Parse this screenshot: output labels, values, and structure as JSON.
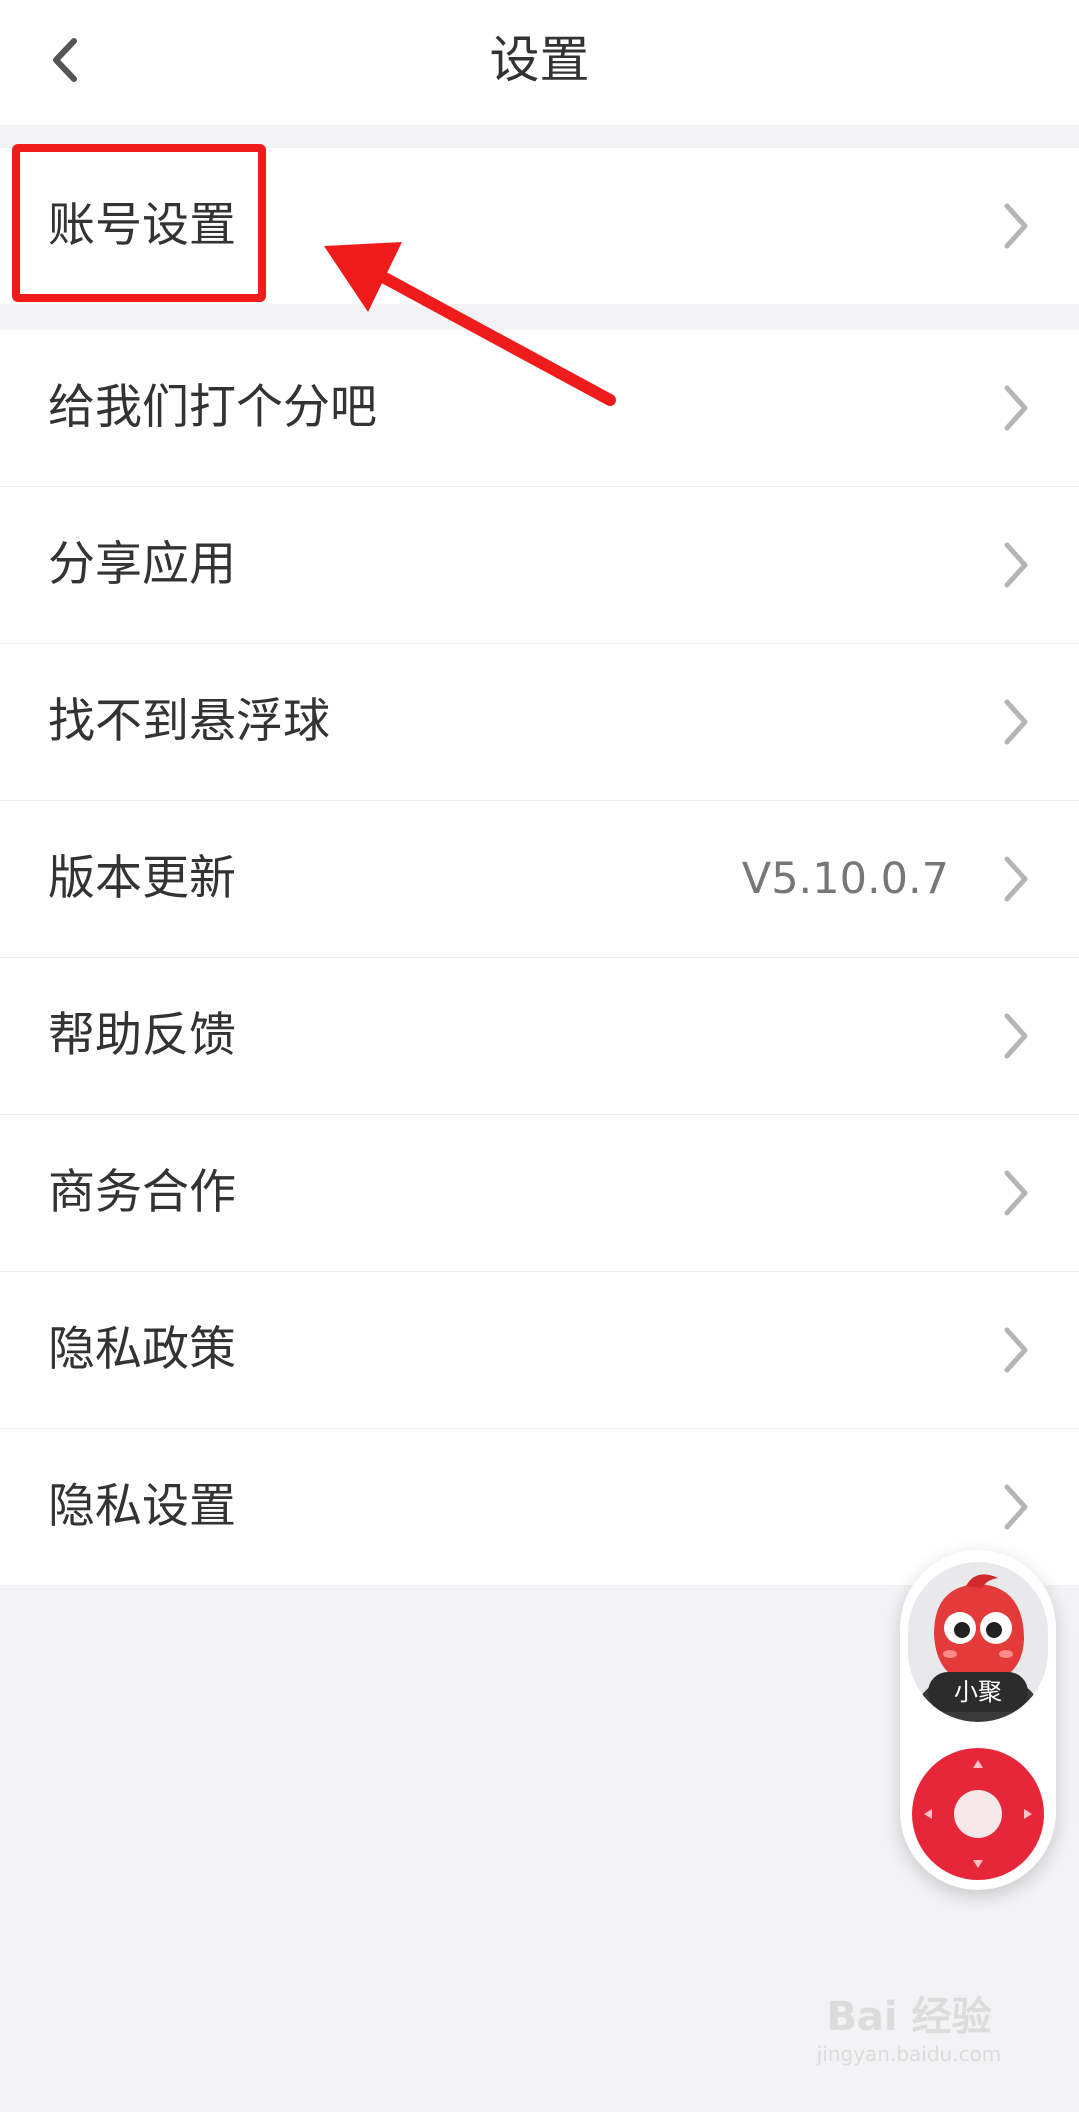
{
  "header": {
    "title": "设置",
    "back_icon": "chevron-left-icon"
  },
  "group1": {
    "items": [
      {
        "label": "账号设置"
      }
    ]
  },
  "group2": {
    "items": [
      {
        "label": "给我们打个分吧"
      },
      {
        "label": "分享应用"
      },
      {
        "label": "找不到悬浮球"
      },
      {
        "label": "版本更新",
        "value": "V5.10.0.7"
      },
      {
        "label": "帮助反馈"
      },
      {
        "label": "商务合作"
      },
      {
        "label": "隐私政策"
      },
      {
        "label": "隐私设置"
      }
    ]
  },
  "floating_ball": {
    "mascot_label": "小聚"
  },
  "watermark": {
    "main": "Bai 经验",
    "sub": "jingyan.baidu.com"
  },
  "colors": {
    "annotation": "#f01c1c",
    "joystick": "#e8263a",
    "background": "#f3f3f5"
  }
}
